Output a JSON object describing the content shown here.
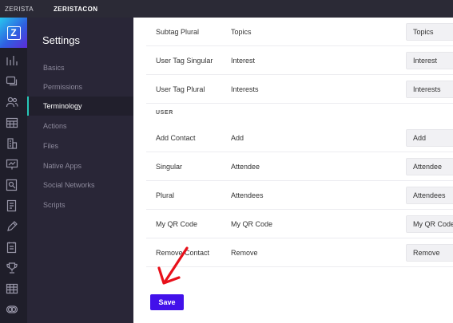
{
  "topbar": {
    "org_name": "ZERISTA",
    "event_name": "ZERISTACON"
  },
  "rail": {
    "logo_letter": "Z",
    "icons": [
      "bar-chart-icon",
      "chat-icon",
      "people-icon",
      "calendar-icon",
      "building-icon",
      "presentation-icon",
      "search-doc-icon",
      "document-icon",
      "pen-icon",
      "notes-icon",
      "trophy-icon",
      "grid-icon",
      "toggle-icon"
    ]
  },
  "sidebar": {
    "title": "Settings",
    "items": [
      {
        "label": "Basics"
      },
      {
        "label": "Permissions"
      },
      {
        "label": "Terminology"
      },
      {
        "label": "Actions"
      },
      {
        "label": "Files"
      },
      {
        "label": "Native Apps"
      },
      {
        "label": "Social Networks"
      },
      {
        "label": "Scripts"
      }
    ]
  },
  "main": {
    "rows_top": [
      {
        "label": "Subtag Plural",
        "default": "Topics",
        "value": "Topics"
      },
      {
        "label": "User Tag Singular",
        "default": "Interest",
        "value": "Interest"
      },
      {
        "label": "User Tag Plural",
        "default": "Interests",
        "value": "Interests"
      }
    ],
    "section_user": "USER",
    "rows_user": [
      {
        "label": "Add Contact",
        "default": "Add",
        "value": "Add"
      },
      {
        "label": "Singular",
        "default": "Attendee",
        "value": "Attendee"
      },
      {
        "label": "Plural",
        "default": "Attendees",
        "value": "Attendees"
      },
      {
        "label": "My QR Code",
        "default": "My QR Code",
        "value": "My QR Code"
      },
      {
        "label": "Remove Contact",
        "default": "Remove",
        "value": "Remove"
      }
    ],
    "save_label": "Save"
  },
  "colors": {
    "topbar": "#2b2a36",
    "rail": "#1f1e2a",
    "sidebar": "#292637",
    "active_indicator": "#27c7b8",
    "save_button": "#4211ea",
    "annotation_arrow": "#e8101a"
  }
}
